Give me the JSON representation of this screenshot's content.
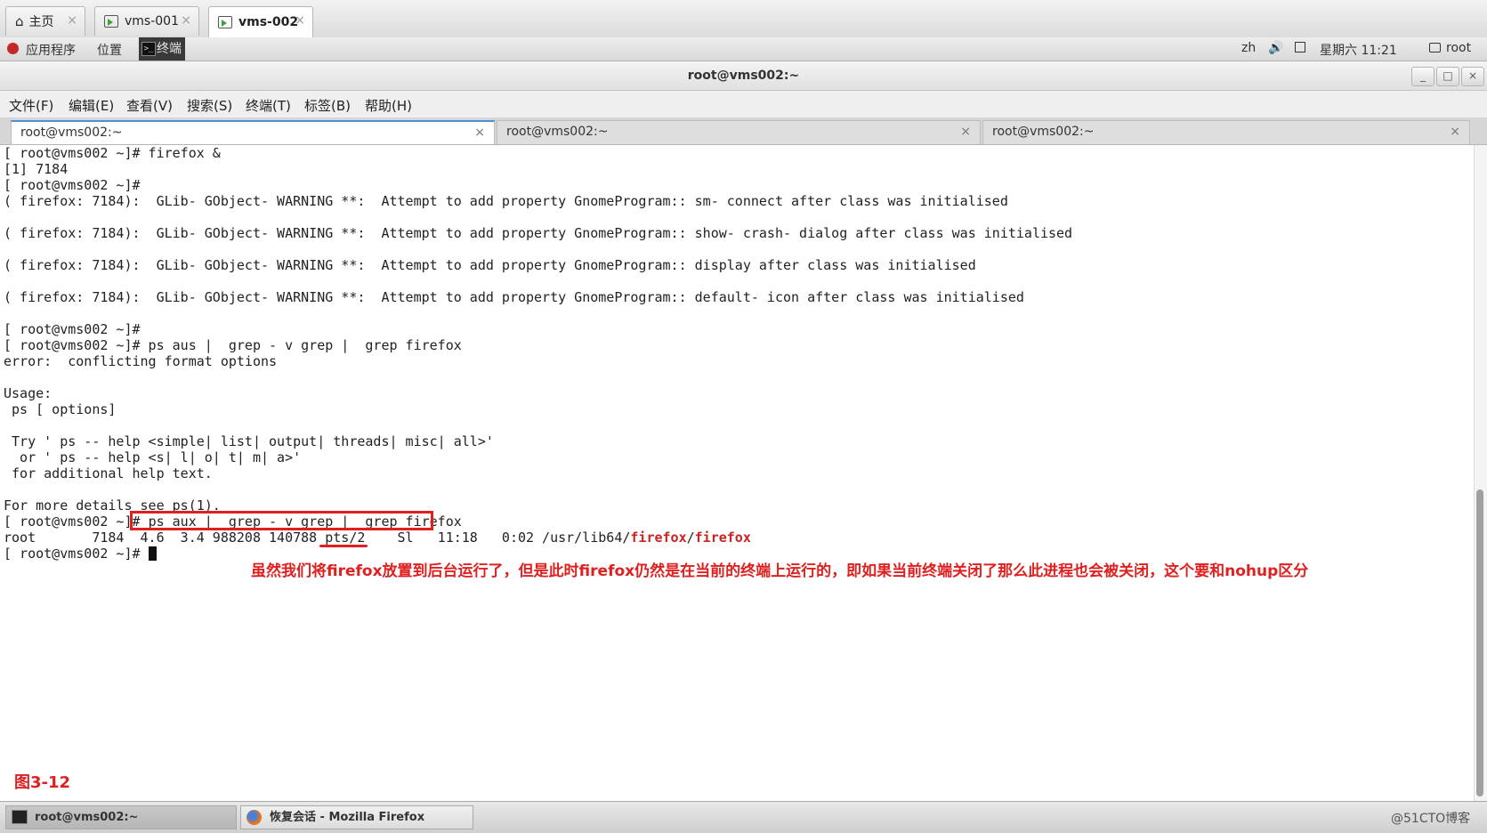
{
  "vm_tabs": [
    {
      "label": "主页",
      "icon": "home-icon"
    },
    {
      "label": "vms-001",
      "icon": "vm-icon"
    },
    {
      "label": "vms-002",
      "icon": "vm-icon",
      "active": true
    }
  ],
  "panel": {
    "applications": "应用程序",
    "places": "位置",
    "terminal": "终端",
    "lang": "zh",
    "clock": "星期六 11:21",
    "user": "root"
  },
  "window": {
    "title": "root@vms002:~",
    "controls": [
      "_",
      "□",
      "×"
    ]
  },
  "menu": [
    "文件(F)",
    "编辑(E)",
    "查看(V)",
    "搜索(S)",
    "终端(T)",
    "标签(B)",
    "帮助(H)"
  ],
  "term_tabs": [
    "root@vms002:~",
    "root@vms002:~",
    "root@vms002:~"
  ],
  "terminal": {
    "lines": [
      "[ root@vms002 ~]# firefox &",
      "[1] 7184",
      "[ root@vms002 ~]#",
      "( firefox: 7184):  GLib- GObject- WARNING **:  Attempt to add property GnomeProgram:: sm- connect after class was initialised",
      "",
      "( firefox: 7184):  GLib- GObject- WARNING **:  Attempt to add property GnomeProgram:: show- crash- dialog after class was initialised",
      "",
      "( firefox: 7184):  GLib- GObject- WARNING **:  Attempt to add property GnomeProgram:: display after class was initialised",
      "",
      "( firefox: 7184):  GLib- GObject- WARNING **:  Attempt to add property GnomeProgram:: default- icon after class was initialised",
      "",
      "[ root@vms002 ~]#",
      "[ root@vms002 ~]# ps aus |  grep - v grep |  grep firefox",
      "error:  conflicting format options",
      "",
      "Usage:",
      " ps [ options]",
      "",
      " Try ' ps -- help <simple| list| output| threads| misc| all>'",
      "  or ' ps -- help <s| l| o| t| m| a>'",
      " for additional help text.",
      "",
      "For more details see ps(1)."
    ],
    "cmd_prompt": "[ root@vms002 ~]# ",
    "cmd": "ps aux |  grep - v grep |  grep firefox",
    "ps_row_prefix": "root       7184  4.6  3.4 988208 140788 pts/2    Sl   11:18   0:02 /usr/lib64/",
    "ps_row_hl1": "firefox",
    "ps_row_sep": "/",
    "ps_row_hl2": "firefox",
    "final_prompt": "[ root@vms002 ~]# "
  },
  "annotation": "虽然我们将firefox放置到后台运行了，但是此时firefox仍然是在当前的终端上运行的，即如果当前终端关闭了那么此进程也会被关闭，这个要和nohup区分",
  "figure_label": "图3-12",
  "taskbar": [
    {
      "label": "root@vms002:~",
      "icon": "terminal-icon",
      "active": true
    },
    {
      "label": "恢复会话 - Mozilla Firefox",
      "icon": "firefox-icon"
    }
  ],
  "watermark": "@51CTO博客",
  "colors": {
    "annotation": "#e02020",
    "highlight": "#cc2222",
    "tab_accent": "#4a90d9"
  }
}
